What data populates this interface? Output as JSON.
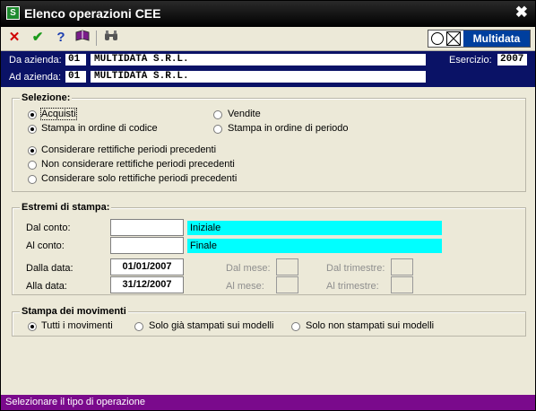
{
  "window": {
    "title": "Elenco operazioni CEE",
    "close_glyph": "✖"
  },
  "toolbar": {
    "buttons": [
      {
        "icon": "cancel-icon",
        "glyph": "✕",
        "color": "#d00000"
      },
      {
        "icon": "confirm-icon",
        "glyph": "✔",
        "color": "#1a9a1a"
      },
      {
        "icon": "help-icon",
        "glyph": "?",
        "color": "#1c3fb0"
      },
      {
        "icon": "book-icon",
        "glyph": "📖",
        "color": "#7a1d8a"
      },
      {
        "icon": "binoculars-icon",
        "glyph": "🔭",
        "color": "#555555"
      }
    ],
    "logo_text": "Multidata"
  },
  "header": {
    "da_azienda_label": "Da azienda:",
    "da_azienda_code": "01",
    "da_azienda_name": "MULTIDATA S.R.L.",
    "ad_azienda_label": "Ad azienda:",
    "ad_azienda_code": "01",
    "ad_azienda_name": "MULTIDATA S.R.L.",
    "esercizio_label": "Esercizio:",
    "esercizio_value": "2007"
  },
  "selezione": {
    "title": "Selezione:",
    "acquisti": "Acquisti",
    "vendite": "Vendite",
    "ordine_codice": "Stampa in ordine di codice",
    "ordine_periodo": "Stampa in ordine di periodo",
    "rett_consider": "Considerare rettifiche periodi precedenti",
    "rett_non": "Non considerare rettifiche periodi precedenti",
    "rett_solo": "Considerare solo rettifiche periodi precedenti"
  },
  "estremi": {
    "title": "Estremi di stampa:",
    "dal_conto_label": "Dal conto:",
    "dal_conto_value": "",
    "dal_conto_desc": "Iniziale",
    "al_conto_label": "Al conto:",
    "al_conto_value": "",
    "al_conto_desc": "Finale",
    "dalla_data_label": "Dalla data:",
    "dalla_data_value": "01/01/2007",
    "alla_data_label": "Alla data:",
    "alla_data_value": "31/12/2007",
    "dal_mese_label": "Dal mese:",
    "al_mese_label": "Al mese:",
    "dal_trimestre_label": "Dal trimestre:",
    "al_trimestre_label": "Al trimestre:"
  },
  "movimenti": {
    "title": "Stampa dei movimenti",
    "tutti": "Tutti i movimenti",
    "gia_stampati": "Solo già stampati sui modelli",
    "non_stampati": "Solo non stampati sui modelli"
  },
  "status_bar": {
    "text": "Selezionare il tipo di operazione"
  },
  "colors": {
    "header_bg": "#0a1266",
    "status_bg": "#7a0a8c",
    "cyan": "#00ffff"
  }
}
